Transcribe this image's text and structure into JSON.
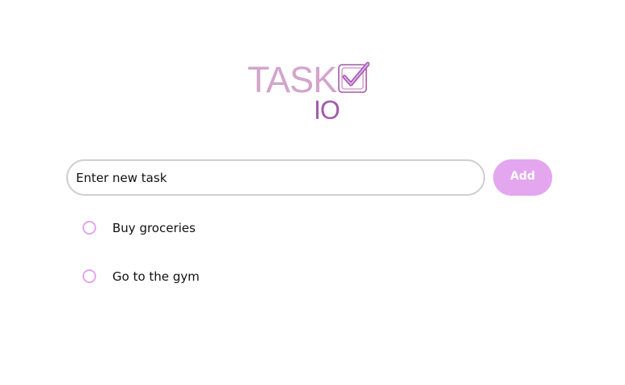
{
  "logo": {
    "word": "TASK",
    "sub": "IO",
    "primary_color": "#d3a5cb",
    "secondary_color": "#a15aa9",
    "icon": "checkbox-check-icon"
  },
  "task_form": {
    "input_value": "",
    "placeholder": "Enter new task",
    "add_label": "Add",
    "accent_color": "#e3a6ef"
  },
  "tasks": [
    {
      "label": "Buy groceries",
      "done": false
    },
    {
      "label": "Go to the gym",
      "done": false
    }
  ]
}
